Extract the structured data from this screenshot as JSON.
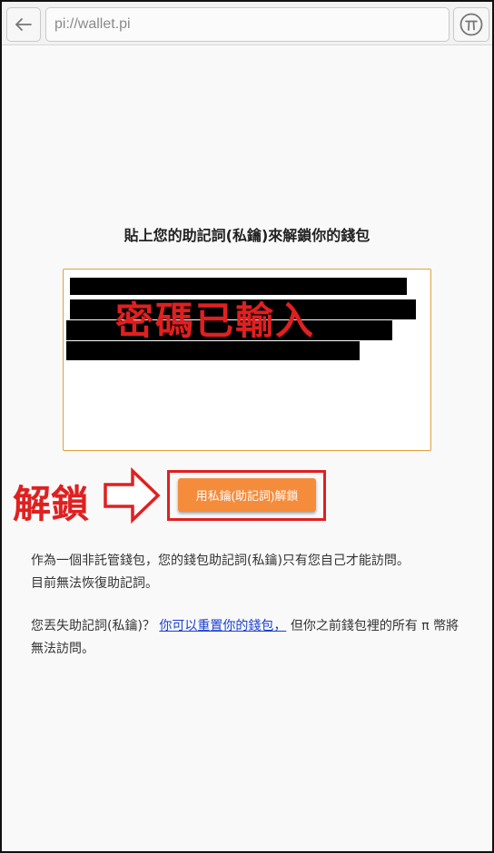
{
  "browser": {
    "url": "pi://wallet.pi",
    "back_icon": "arrow-left-icon",
    "pi_icon": "pi-icon"
  },
  "wallet": {
    "heading": "貼上您的助記詞(私鑰)來解鎖你的錢包",
    "mnemonic_overlay": "密碼已輸入",
    "unlock_annotation": "解鎖",
    "unlock_button": "用私鑰(助記詞)解鎖",
    "info_line1": "作為一個非託管錢包，您的錢包助記詞(私鑰)只有您自己才能訪問。",
    "info_line2": "目前無法恢復助記詞。",
    "lost_prefix": "您丟失助記詞(私鑰)？ ",
    "reset_link": "你可以重置你的錢包，",
    "lost_suffix": " 但你之前錢包裡的所有 π 幣將無法訪問。"
  },
  "colors": {
    "accent_orange": "#f58c3c",
    "annotation_red": "#e02020",
    "link_blue": "#1a3fd0"
  }
}
